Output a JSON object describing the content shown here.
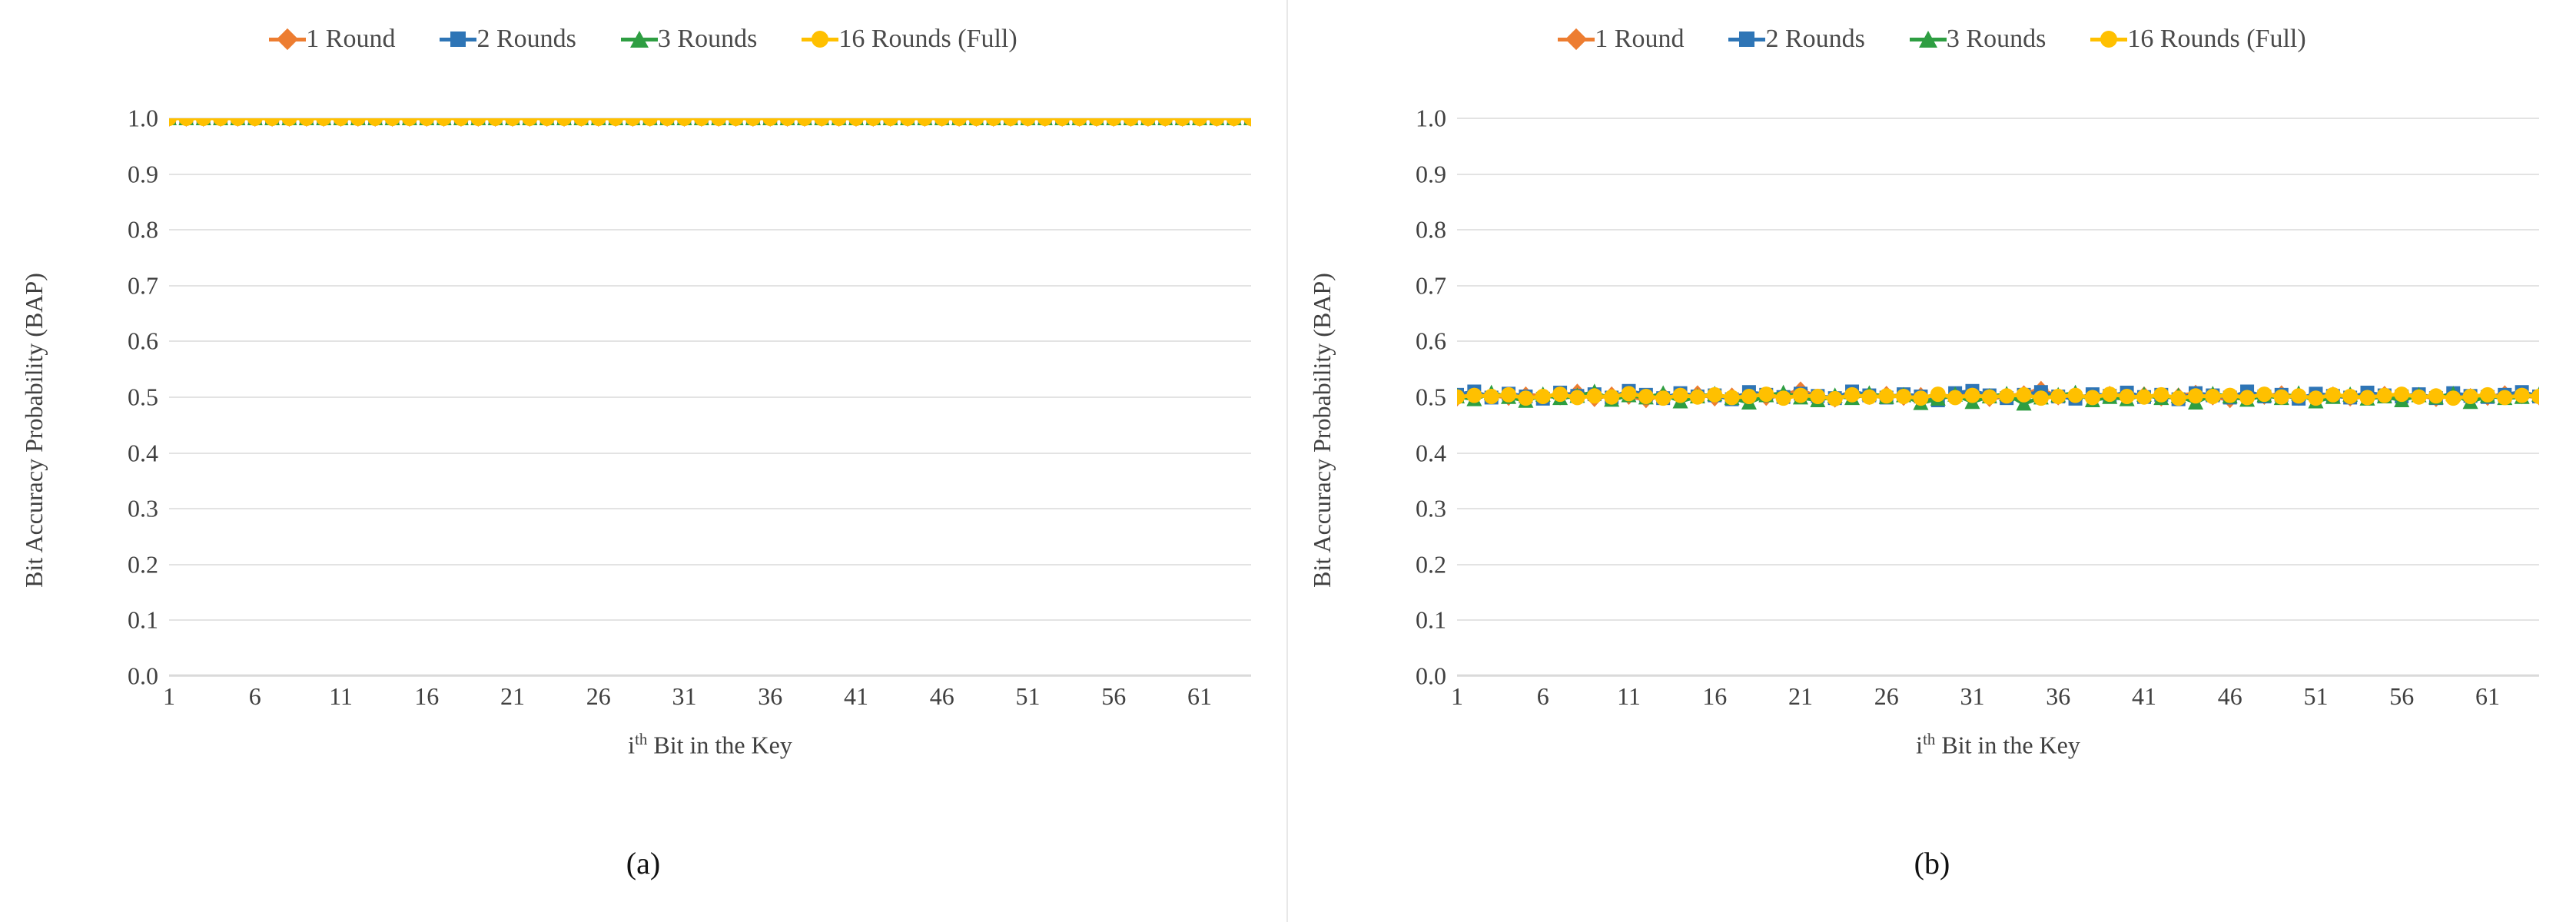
{
  "figure": {
    "panels": [
      {
        "caption": "(a)",
        "legend": [
          {
            "label": "1 Round",
            "color": "#ED7D31",
            "marker": "diamond"
          },
          {
            "label": "2 Rounds",
            "color": "#2E75B6",
            "marker": "square"
          },
          {
            "label": "3 Rounds",
            "color": "#2E9E42",
            "marker": "triangle"
          },
          {
            "label": "16 Rounds (Full)",
            "color": "#FFC000",
            "marker": "circle"
          }
        ],
        "chart_data": {
          "type": "line",
          "title": "",
          "xlabel": "i<sup>th</sup> Bit in the Key",
          "xlabel_text": "ith Bit in the Key",
          "ylabel": "Bit Accuracy Probability (BAP)",
          "xlim": [
            1,
            64
          ],
          "ylim": [
            0.0,
            1.0
          ],
          "grid": true,
          "legend_position": "top-center",
          "xticks": [
            1,
            6,
            11,
            16,
            21,
            26,
            31,
            36,
            41,
            46,
            51,
            56,
            61
          ],
          "yticks": [
            "0.0",
            "0.1",
            "0.2",
            "0.3",
            "0.4",
            "0.5",
            "0.6",
            "0.7",
            "0.8",
            "0.9",
            "1.0"
          ],
          "x": [
            1,
            2,
            3,
            4,
            5,
            6,
            7,
            8,
            9,
            10,
            11,
            12,
            13,
            14,
            15,
            16,
            17,
            18,
            19,
            20,
            21,
            22,
            23,
            24,
            25,
            26,
            27,
            28,
            29,
            30,
            31,
            32,
            33,
            34,
            35,
            36,
            37,
            38,
            39,
            40,
            41,
            42,
            43,
            44,
            45,
            46,
            47,
            48,
            49,
            50,
            51,
            52,
            53,
            54,
            55,
            56,
            57,
            58,
            59,
            60,
            61,
            62,
            63,
            64
          ],
          "series": [
            {
              "name": "1 Round",
              "color": "#ED7D31",
              "marker": "diamond",
              "values": [
                1,
                1,
                1,
                1,
                1,
                1,
                1,
                1,
                1,
                1,
                1,
                1,
                1,
                1,
                1,
                1,
                1,
                1,
                1,
                1,
                1,
                1,
                1,
                1,
                1,
                1,
                1,
                1,
                1,
                1,
                1,
                1,
                1,
                1,
                1,
                1,
                1,
                1,
                1,
                1,
                1,
                1,
                1,
                1,
                1,
                1,
                1,
                1,
                1,
                1,
                1,
                1,
                1,
                1,
                1,
                1,
                1,
                1,
                1,
                1,
                1,
                1,
                1,
                1
              ]
            },
            {
              "name": "2 Rounds",
              "color": "#2E75B6",
              "marker": "square",
              "values": [
                1,
                1,
                1,
                1,
                1,
                1,
                1,
                1,
                1,
                1,
                1,
                1,
                1,
                1,
                1,
                1,
                1,
                1,
                1,
                1,
                1,
                1,
                1,
                1,
                1,
                1,
                1,
                1,
                1,
                1,
                1,
                1,
                1,
                1,
                1,
                1,
                1,
                1,
                1,
                1,
                1,
                1,
                1,
                1,
                1,
                1,
                1,
                1,
                1,
                1,
                1,
                1,
                1,
                1,
                1,
                1,
                1,
                1,
                1,
                1,
                1,
                1,
                1,
                1
              ]
            },
            {
              "name": "3 Rounds",
              "color": "#2E9E42",
              "marker": "triangle",
              "values": [
                1,
                1,
                1,
                1,
                1,
                1,
                1,
                1,
                1,
                1,
                1,
                1,
                1,
                1,
                1,
                1,
                1,
                1,
                1,
                1,
                1,
                1,
                1,
                1,
                1,
                1,
                1,
                1,
                1,
                1,
                1,
                1,
                1,
                1,
                1,
                1,
                1,
                1,
                1,
                1,
                1,
                1,
                1,
                1,
                1,
                1,
                1,
                1,
                1,
                1,
                1,
                1,
                1,
                1,
                1,
                1,
                1,
                1,
                1,
                1,
                1,
                1,
                1,
                1
              ]
            },
            {
              "name": "16 Rounds (Full)",
              "color": "#FFC000",
              "marker": "circle",
              "values": [
                1,
                1,
                1,
                1,
                1,
                1,
                1,
                1,
                1,
                1,
                1,
                1,
                1,
                1,
                1,
                1,
                1,
                1,
                1,
                1,
                1,
                1,
                1,
                1,
                1,
                1,
                1,
                1,
                1,
                1,
                1,
                1,
                1,
                1,
                1,
                1,
                1,
                1,
                1,
                1,
                1,
                1,
                1,
                1,
                1,
                1,
                1,
                1,
                1,
                1,
                1,
                1,
                1,
                1,
                1,
                1,
                1,
                1,
                1,
                1,
                1,
                1,
                1,
                1
              ]
            }
          ]
        }
      },
      {
        "caption": "(b)",
        "legend": [
          {
            "label": "1 Round",
            "color": "#ED7D31",
            "marker": "diamond"
          },
          {
            "label": "2 Rounds",
            "color": "#2E75B6",
            "marker": "square"
          },
          {
            "label": "3 Rounds",
            "color": "#2E9E42",
            "marker": "triangle"
          },
          {
            "label": "16 Rounds (Full)",
            "color": "#FFC000",
            "marker": "circle"
          }
        ],
        "chart_data": {
          "type": "line",
          "title": "",
          "xlabel": "i<sup>th</sup> Bit in the Key",
          "xlabel_text": "ith Bit in the Key",
          "ylabel": "Bit Accuracy Probability (BAP)",
          "xlim": [
            1,
            64
          ],
          "ylim": [
            0.0,
            1.0
          ],
          "grid": true,
          "legend_position": "top-center",
          "xticks": [
            1,
            6,
            11,
            16,
            21,
            26,
            31,
            36,
            41,
            46,
            51,
            56,
            61
          ],
          "yticks": [
            "0.0",
            "0.1",
            "0.2",
            "0.3",
            "0.4",
            "0.5",
            "0.6",
            "0.7",
            "0.8",
            "0.9",
            "1.0"
          ],
          "x": [
            1,
            2,
            3,
            4,
            5,
            6,
            7,
            8,
            9,
            10,
            11,
            12,
            13,
            14,
            15,
            16,
            17,
            18,
            19,
            20,
            21,
            22,
            23,
            24,
            25,
            26,
            27,
            28,
            29,
            30,
            31,
            32,
            33,
            34,
            35,
            36,
            37,
            38,
            39,
            40,
            41,
            42,
            43,
            44,
            45,
            46,
            47,
            48,
            49,
            50,
            51,
            52,
            53,
            54,
            55,
            56,
            57,
            58,
            59,
            60,
            61,
            62,
            63,
            64
          ],
          "series": [
            {
              "name": "1 Round",
              "color": "#ED7D31",
              "marker": "diamond",
              "values": [
                0.497,
                0.505,
                0.502,
                0.498,
                0.503,
                0.501,
                0.499,
                0.508,
                0.496,
                0.503,
                0.5,
                0.494,
                0.502,
                0.499,
                0.505,
                0.497,
                0.501,
                0.503,
                0.498,
                0.502,
                0.512,
                0.499,
                0.495,
                0.503,
                0.5,
                0.504,
                0.498,
                0.502,
                0.497,
                0.501,
                0.503,
                0.496,
                0.5,
                0.505,
                0.513,
                0.499,
                0.502,
                0.498,
                0.504,
                0.5,
                0.503,
                0.497,
                0.501,
                0.506,
                0.499,
                0.494,
                0.502,
                0.5,
                0.505,
                0.498,
                0.501,
                0.503,
                0.497,
                0.5,
                0.504,
                0.499,
                0.502,
                0.496,
                0.503,
                0.5,
                0.498,
                0.505,
                0.501,
                0.499
              ]
            },
            {
              "name": "2 Rounds",
              "color": "#2E75B6",
              "marker": "square",
              "values": [
                0.503,
                0.509,
                0.498,
                0.505,
                0.5,
                0.496,
                0.507,
                0.501,
                0.504,
                0.498,
                0.51,
                0.503,
                0.497,
                0.506,
                0.5,
                0.502,
                0.495,
                0.508,
                0.503,
                0.499,
                0.505,
                0.501,
                0.497,
                0.509,
                0.502,
                0.498,
                0.504,
                0.5,
                0.493,
                0.506,
                0.51,
                0.502,
                0.497,
                0.503,
                0.508,
                0.5,
                0.496,
                0.504,
                0.501,
                0.507,
                0.499,
                0.503,
                0.495,
                0.506,
                0.502,
                0.498,
                0.509,
                0.5,
                0.503,
                0.496,
                0.505,
                0.501,
                0.498,
                0.507,
                0.502,
                0.5,
                0.504,
                0.497,
                0.506,
                0.501,
                0.499,
                0.503,
                0.508,
                0.5
              ]
            },
            {
              "name": "3 Rounds",
              "color": "#2E9E42",
              "marker": "triangle",
              "values": [
                0.5,
                0.495,
                0.506,
                0.499,
                0.492,
                0.503,
                0.497,
                0.501,
                0.508,
                0.494,
                0.502,
                0.498,
                0.505,
                0.491,
                0.5,
                0.504,
                0.497,
                0.489,
                0.502,
                0.506,
                0.498,
                0.493,
                0.501,
                0.497,
                0.505,
                0.499,
                0.502,
                0.488,
                0.496,
                0.503,
                0.49,
                0.5,
                0.504,
                0.487,
                0.498,
                0.502,
                0.506,
                0.493,
                0.499,
                0.495,
                0.503,
                0.497,
                0.501,
                0.489,
                0.504,
                0.5,
                0.494,
                0.502,
                0.497,
                0.505,
                0.491,
                0.499,
                0.503,
                0.496,
                0.5,
                0.493,
                0.502,
                0.498,
                0.504,
                0.49,
                0.501,
                0.497,
                0.499,
                0.503
              ]
            },
            {
              "name": "16 Rounds (Full)",
              "color": "#FFC000",
              "marker": "circle",
              "values": [
                0.499,
                0.502,
                0.5,
                0.503,
                0.497,
                0.5,
                0.504,
                0.498,
                0.501,
                0.499,
                0.505,
                0.5,
                0.497,
                0.502,
                0.499,
                0.503,
                0.498,
                0.5,
                0.504,
                0.497,
                0.502,
                0.5,
                0.496,
                0.503,
                0.499,
                0.501,
                0.5,
                0.497,
                0.504,
                0.498,
                0.502,
                0.499,
                0.501,
                0.503,
                0.497,
                0.5,
                0.502,
                0.498,
                0.504,
                0.5,
                0.499,
                0.503,
                0.497,
                0.501,
                0.5,
                0.502,
                0.498,
                0.504,
                0.499,
                0.501,
                0.497,
                0.503,
                0.5,
                0.498,
                0.502,
                0.504,
                0.499,
                0.501,
                0.497,
                0.5,
                0.503,
                0.498,
                0.502,
                0.5
              ]
            }
          ]
        }
      }
    ]
  }
}
